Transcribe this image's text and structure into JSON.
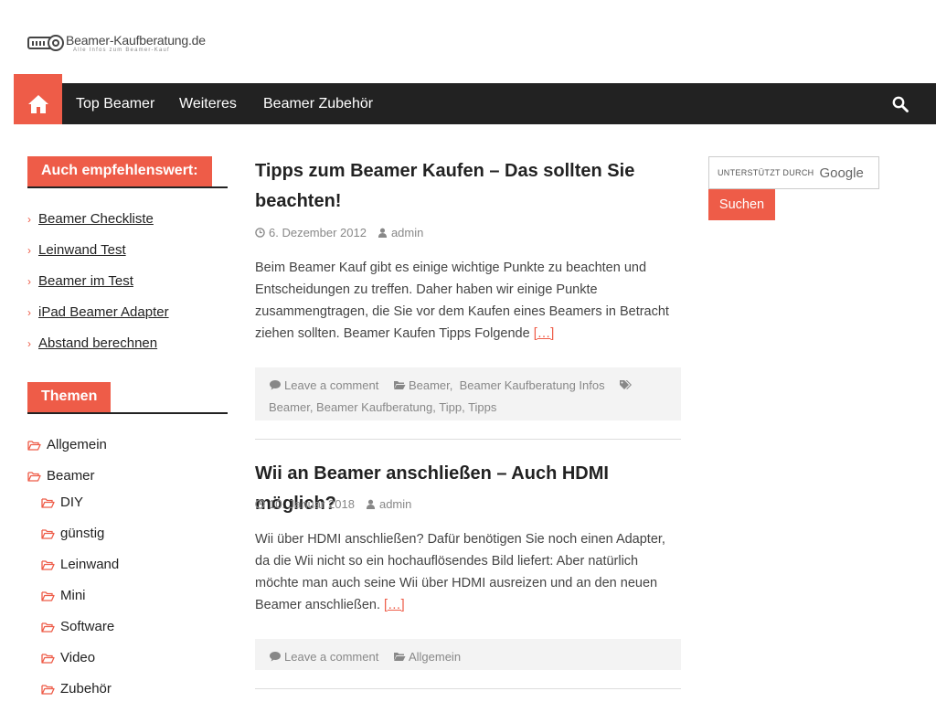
{
  "site": {
    "title": "Beamer-Kaufberatung.de",
    "tagline": "Alle Infos zum Beamer-Kauf",
    "accent": "#ee5c48"
  },
  "nav": {
    "home_icon": "home-icon",
    "items": [
      "Top Beamer",
      "Weiteres",
      "Beamer Zubehör"
    ],
    "search_icon": "search-icon"
  },
  "sidebar": {
    "recommend_heading": "Auch empfehlenswert:",
    "links": [
      "Beamer Checkliste",
      "Leinwand Test",
      "Beamer im Test",
      "iPad Beamer Adapter",
      "Abstand berechnen"
    ],
    "themes_heading": "Themen",
    "categories": [
      {
        "label": "Allgemein"
      },
      {
        "label": "Beamer"
      },
      {
        "label": "DIY"
      },
      {
        "label": "günstig"
      },
      {
        "label": "Leinwand"
      },
      {
        "label": "Mini"
      },
      {
        "label": "Software"
      },
      {
        "label": "Video"
      },
      {
        "label": "Zubehör"
      }
    ]
  },
  "posts": [
    {
      "title": "Tipps zum Beamer Kaufen – Das sollten Sie beachten!",
      "date": "6. Dezember 2012",
      "author": "admin",
      "excerpt": "Beim Beamer Kauf gibt es einige wichtige Punkte zu beachten und Entscheidungen zu treffen. Daher haben wir einige Punkte zusammengtragen, die Sie vor dem Kaufen eines Beamers in Betracht ziehen sollten. Beamer Kaufen Tipps Folgende",
      "more": "[…]",
      "comment": "Leave a comment",
      "categories": [
        "Beamer",
        "Beamer Kaufberatung Infos"
      ],
      "tags": [
        "Beamer",
        "Beamer Kaufberatung",
        "Tipp",
        "Tipps"
      ]
    },
    {
      "title": "Wii an Beamer anschließen – Auch HDMI möglich?",
      "date": "10. Januar 2018",
      "author": "admin",
      "excerpt": "Wii über HDMI anschließen? Dafür benötigen Sie noch einen Adapter, da die Wii nicht so ein hochauflösendes Bild liefert: Aber natürlich möchte man auch seine Wii über HDMI ausreizen und an den neuen Beamer anschließen.",
      "more": "[…]",
      "comment": "Leave a comment",
      "categories": [
        "Allgemein"
      ]
    }
  ],
  "search": {
    "powered_by": "UNTERSTÜTZT DURCH",
    "provider": "Google",
    "button": "Suchen"
  }
}
